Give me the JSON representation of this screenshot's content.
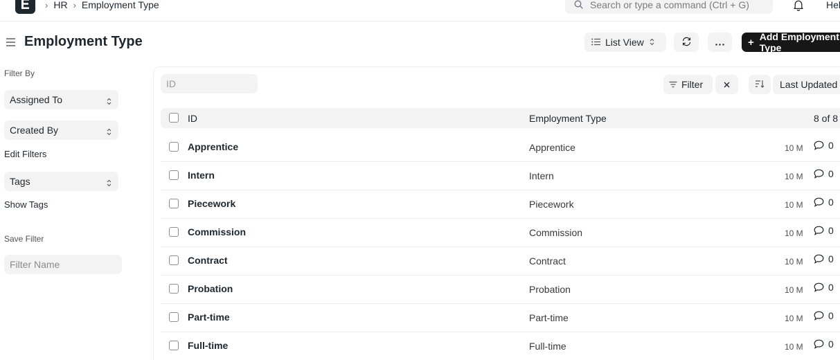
{
  "navbar": {
    "breadcrumbs": [
      "HR",
      "Employment Type"
    ],
    "search_placeholder": "Search or type a command (Ctrl + G)",
    "help_label": "Hel"
  },
  "page": {
    "title": "Employment Type",
    "list_view_label": "List View",
    "add_button_label": "Add Employment Type"
  },
  "sidebar": {
    "filter_by_label": "Filter By",
    "assigned_to_label": "Assigned To",
    "created_by_label": "Created By",
    "edit_filters_label": "Edit Filters",
    "tags_label": "Tags",
    "show_tags_label": "Show Tags",
    "save_filter_label": "Save Filter",
    "filter_name_placeholder": "Filter Name"
  },
  "toolbar": {
    "id_placeholder": "ID",
    "filter_label": "Filter",
    "sort_label": "Last Updated On"
  },
  "list": {
    "columns": {
      "id": "ID",
      "type": "Employment Type",
      "count": "8 of 8"
    },
    "rows": [
      {
        "id": "Apprentice",
        "type": "Apprentice",
        "time": "10 M",
        "comments": "0"
      },
      {
        "id": "Intern",
        "type": "Intern",
        "time": "10 M",
        "comments": "0"
      },
      {
        "id": "Piecework",
        "type": "Piecework",
        "time": "10 M",
        "comments": "0"
      },
      {
        "id": "Commission",
        "type": "Commission",
        "time": "10 M",
        "comments": "0"
      },
      {
        "id": "Contract",
        "type": "Contract",
        "time": "10 M",
        "comments": "0"
      },
      {
        "id": "Probation",
        "type": "Probation",
        "time": "10 M",
        "comments": "0"
      },
      {
        "id": "Part-time",
        "type": "Part-time",
        "time": "10 M",
        "comments": "0"
      },
      {
        "id": "Full-time",
        "type": "Full-time",
        "time": "10 M",
        "comments": "0"
      }
    ]
  },
  "icons": {
    "logo": "app-logo-icon",
    "search": "search-icon",
    "bell": "bell-icon",
    "menu": "hamburger-icon",
    "reload": "refresh-icon",
    "more": "ellipsis-icon",
    "filter": "filter-icon",
    "clear": "close-icon",
    "sort": "sort-icon",
    "comment": "comment-icon"
  },
  "colors": {
    "primary_button": "#171717",
    "control_bg": "#f3f3f3",
    "text": "#1f272e",
    "border": "#ebeef0"
  }
}
